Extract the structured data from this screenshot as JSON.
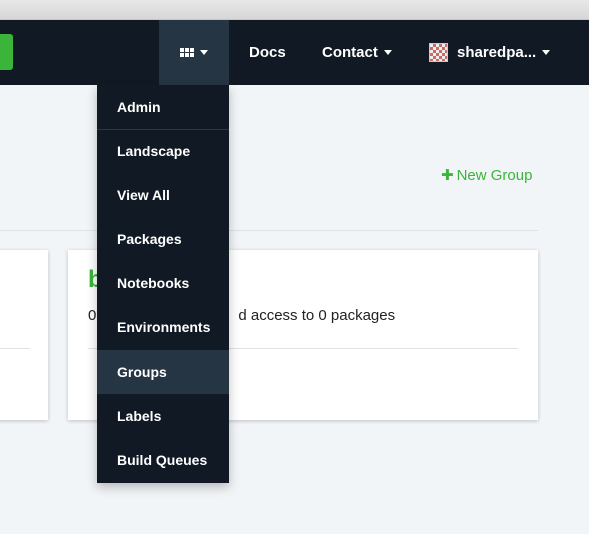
{
  "navbar": {
    "apps_icon": "grid-icon",
    "docs_label": "Docs",
    "contact_label": "Contact",
    "user_name": "sharedpa...",
    "avatar_icon": "identicon-avatar"
  },
  "dropdown": {
    "items": [
      {
        "label": "Admin",
        "active": false
      },
      {
        "label": "Landscape",
        "active": false
      },
      {
        "label": "View All",
        "active": false
      },
      {
        "label": "Packages",
        "active": false
      },
      {
        "label": "Notebooks",
        "active": false
      },
      {
        "label": "Environments",
        "active": false
      },
      {
        "label": "Groups",
        "active": true
      },
      {
        "label": "Labels",
        "active": false
      },
      {
        "label": "Build Queues",
        "active": false
      }
    ]
  },
  "main": {
    "new_group_label": "New Group",
    "new_group_icon": "plus-icon",
    "group_card": {
      "title_visible": "b",
      "description_prefix": "0",
      "description_suffix": "d access to 0 packages"
    }
  },
  "colors": {
    "navbar_bg": "#111a24",
    "active_bg": "#263544",
    "accent_green": "#3ab53a",
    "page_bg": "#f2f5f8"
  }
}
